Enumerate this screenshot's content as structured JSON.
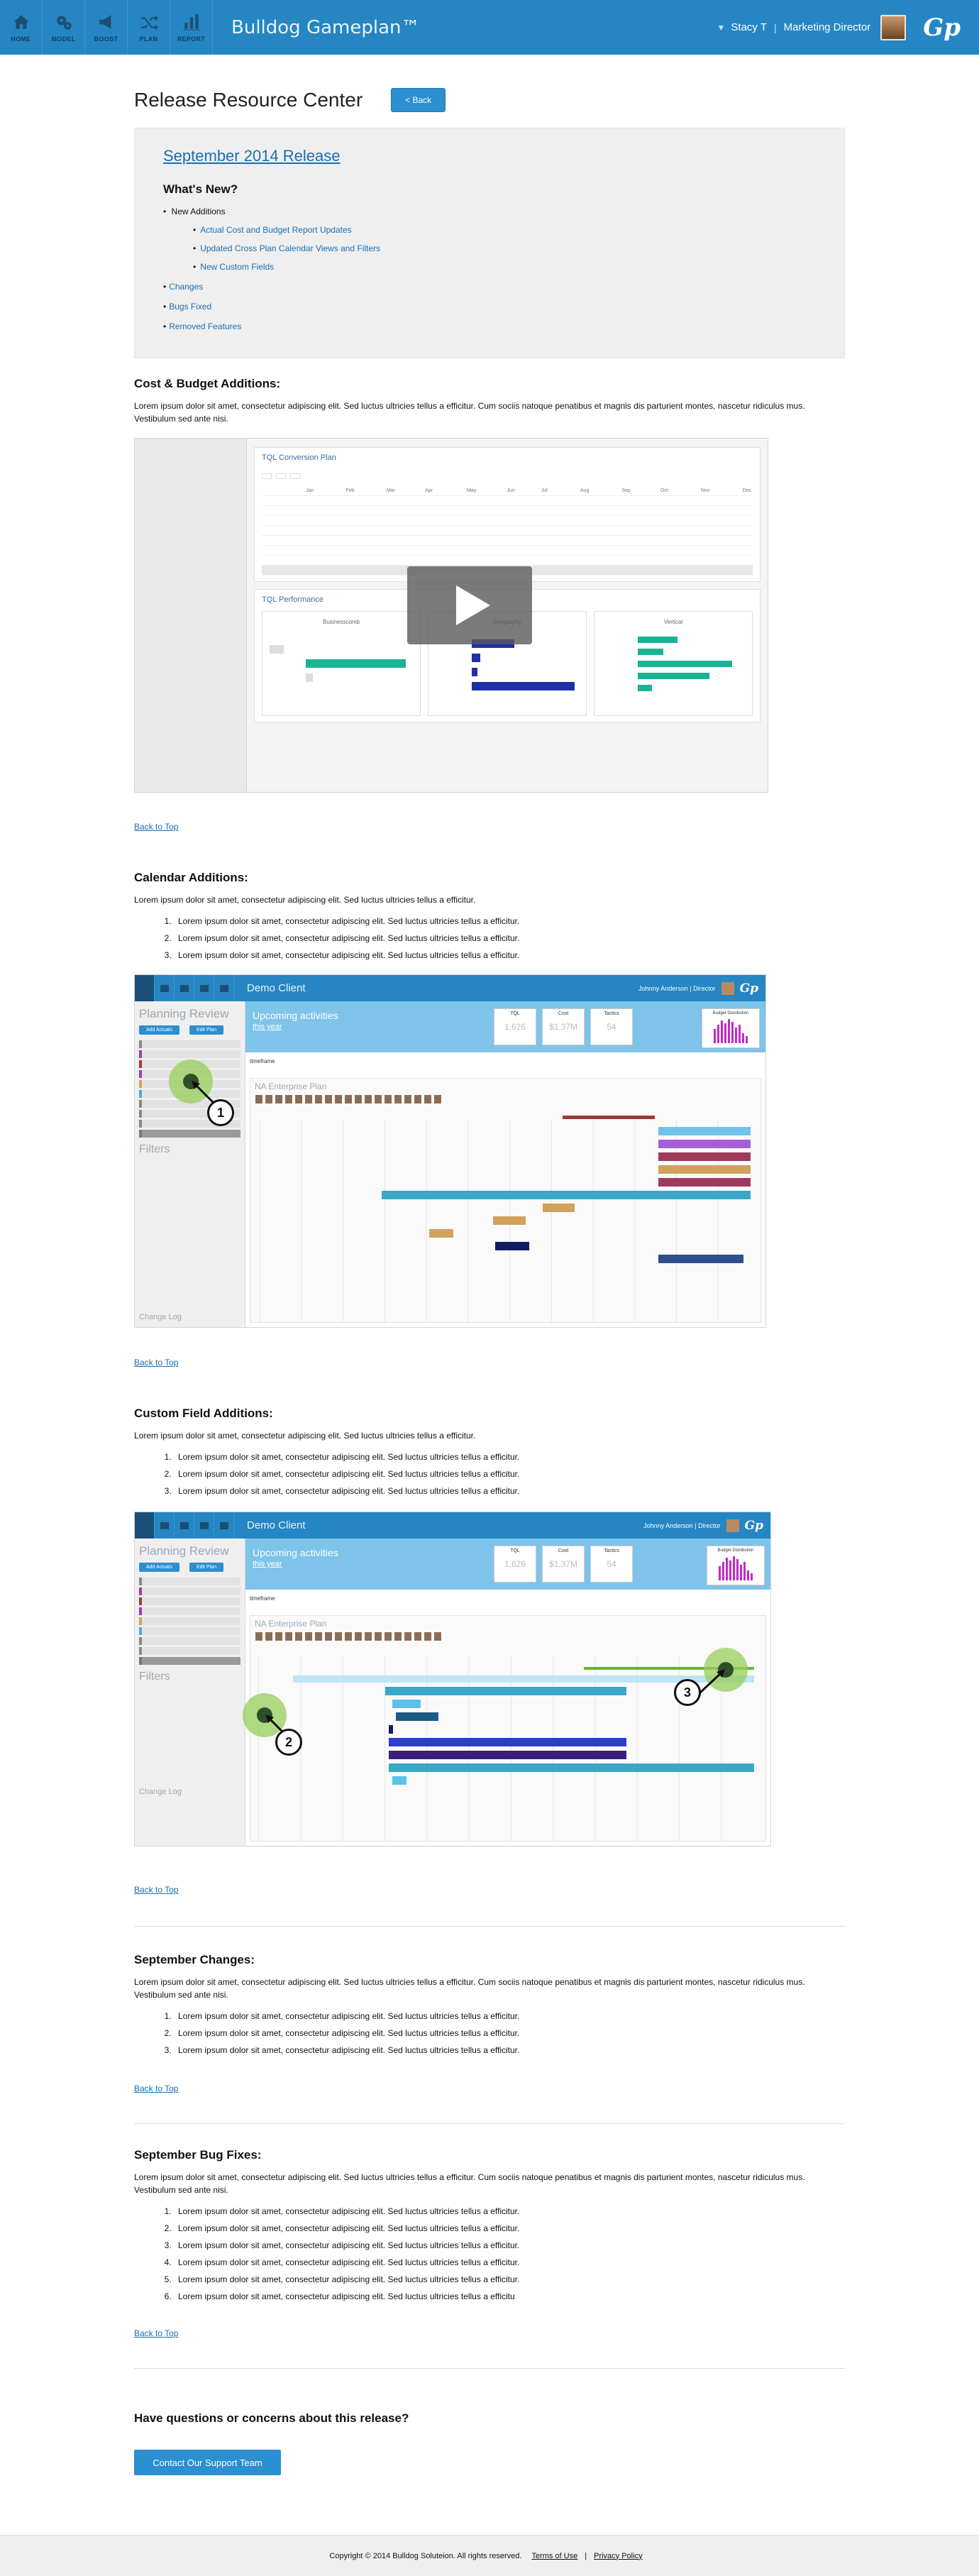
{
  "nav": {
    "items": [
      {
        "label": "HOME",
        "icon": "home-icon"
      },
      {
        "label": "MODEL",
        "icon": "gears-icon"
      },
      {
        "label": "BOOST",
        "icon": "megaphone-icon"
      },
      {
        "label": "PLAN",
        "icon": "shuffle-icon"
      },
      {
        "label": "REPORT",
        "icon": "bar-chart-icon"
      }
    ],
    "brand": "Bulldog Gameplan™",
    "user_name": "Stacy T",
    "user_separator": "|",
    "user_role": "Marketing Director",
    "logo": "Gp"
  },
  "page": {
    "title": "Release Resource Center",
    "back_button": "< Back"
  },
  "release": {
    "title": "September 2014 Release",
    "whats_new": "What's New?",
    "new_additions_label": "New Additions",
    "new_additions": [
      "Actual Cost and Budget Report Updates",
      "Updated Cross Plan Calendar Views and Filters",
      "New Custom Fields"
    ],
    "links": [
      "Changes",
      "Bugs Fixed",
      "Removed Features"
    ]
  },
  "sections": {
    "cost_budget": {
      "heading": "Cost & Budget Additions:",
      "text": "Lorem ipsum dolor sit amet, consectetur adipiscing elit. Sed luctus ultricies tellus a efficitur. Cum sociis natoque penatibus et magnis dis parturient montes, nascetur ridiculus mus. Vestibulum sed ante nisi."
    },
    "calendar": {
      "heading": "Calendar Additions:",
      "text": "Lorem ipsum dolor sit amet, consectetur adipiscing elit. Sed luctus ultricies tellus a efficitur.",
      "items": [
        "Lorem ipsum dolor sit amet, consectetur adipiscing elit. Sed luctus ultricies tellus a efficitur.",
        "Lorem ipsum dolor sit amet, consectetur adipiscing elit. Sed luctus ultricies tellus a efficitur.",
        "Lorem ipsum dolor sit amet, consectetur adipiscing elit. Sed luctus ultricies tellus a efficitur."
      ]
    },
    "custom_fields": {
      "heading": "Custom Field Additions:",
      "text": "Lorem ipsum dolor sit amet, consectetur adipiscing elit. Sed luctus ultricies tellus a efficitur.",
      "items": [
        "Lorem ipsum dolor sit amet, consectetur adipiscing elit. Sed luctus ultricies tellus a efficitur.",
        "Lorem ipsum dolor sit amet, consectetur adipiscing elit. Sed luctus ultricies tellus a efficitur.",
        "Lorem ipsum dolor sit amet, consectetur adipiscing elit. Sed luctus ultricies tellus a efficitur."
      ]
    },
    "changes": {
      "heading": "September Changes:",
      "text": "Lorem ipsum dolor sit amet, consectetur adipiscing elit. Sed luctus ultricies tellus a efficitur. Cum sociis natoque penatibus et magnis dis parturient montes, nascetur ridiculus mus. Vestibulum sed ante nisi.",
      "items": [
        "Lorem ipsum dolor sit amet, consectetur adipiscing elit. Sed luctus ultricies tellus a efficitur.",
        "Lorem ipsum dolor sit amet, consectetur adipiscing elit. Sed luctus ultricies tellus a efficitur.",
        "Lorem ipsum dolor sit amet, consectetur adipiscing elit. Sed luctus ultricies tellus a efficitur."
      ]
    },
    "bugs": {
      "heading": "September Bug Fixes:",
      "text": "Lorem ipsum dolor sit amet, consectetur adipiscing elit. Sed luctus ultricies tellus a efficitur. Cum sociis natoque penatibus et magnis dis parturient montes, nascetur ridiculus mus. Vestibulum sed ante nisi.",
      "items": [
        "Lorem ipsum dolor sit amet, consectetur adipiscing elit. Sed luctus ultricies tellus a efficitur.",
        "Lorem ipsum dolor sit amet, consectetur adipiscing elit. Sed luctus ultricies tellus a efficitur.",
        "Lorem ipsum dolor sit amet, consectetur adipiscing elit. Sed luctus ultricies tellus a efficitur.",
        "Lorem ipsum dolor sit amet, consectetur adipiscing elit. Sed luctus ultricies tellus a efficitur.",
        "Lorem ipsum dolor sit amet, consectetur adipiscing elit. Sed luctus ultricies tellus a efficitur.",
        "Lorem ipsum dolor sit amet, consectetur adipiscing elit. Sed luctus ultricies tellus a efficitu"
      ]
    },
    "questions": {
      "heading": "Have questions or concerns about this release?",
      "button": "Contact Our Support Team"
    }
  },
  "back_to_top": "Back to Top",
  "video_shot": {
    "panel1_title": "TQL Conversion Plan",
    "panel2_title": "TQL Performance",
    "months": [
      "Jan",
      "Feb",
      "Mar",
      "Apr",
      "May",
      "Jun",
      "Jul",
      "Aug",
      "Sep",
      "Oct",
      "Nov",
      "Dec"
    ],
    "cards": [
      "Businesscomb",
      "Geography",
      "Vertical"
    ]
  },
  "app_shot": {
    "client": "Demo Client",
    "user": "Johnny Anderson",
    "role": "Director",
    "logo": "Gp",
    "planning_review": "Planning Review",
    "set_actuals": "Add Actuals",
    "edit_plan": "Edit Plan",
    "filters": "Filters",
    "upcoming": "Upcoming activities",
    "this_year": "this year",
    "stat_labels": [
      "TQL",
      "Cost",
      "Tactics"
    ],
    "stat_values": [
      "1,626",
      "$1.37M",
      "54"
    ],
    "budget_label": "Budget Distribution",
    "timeframe": "timeframe",
    "plan_name": "NA Enterprise Plan",
    "change_log": "Change Log"
  },
  "calendar_callouts": [
    "1"
  ],
  "custom_callouts": [
    "2",
    "3"
  ],
  "footer": {
    "copyright": "Copyright © 2014 Bulldog Soluteion. All rights reserved.",
    "terms": "Terms of Use",
    "separator": "|",
    "privacy": "Privacy Policy"
  },
  "colors": {
    "header_blue": "#2586c3",
    "link_blue": "#1a6eb0",
    "button_blue": "#2b8fd0",
    "callout_green": "#96cd5a"
  }
}
